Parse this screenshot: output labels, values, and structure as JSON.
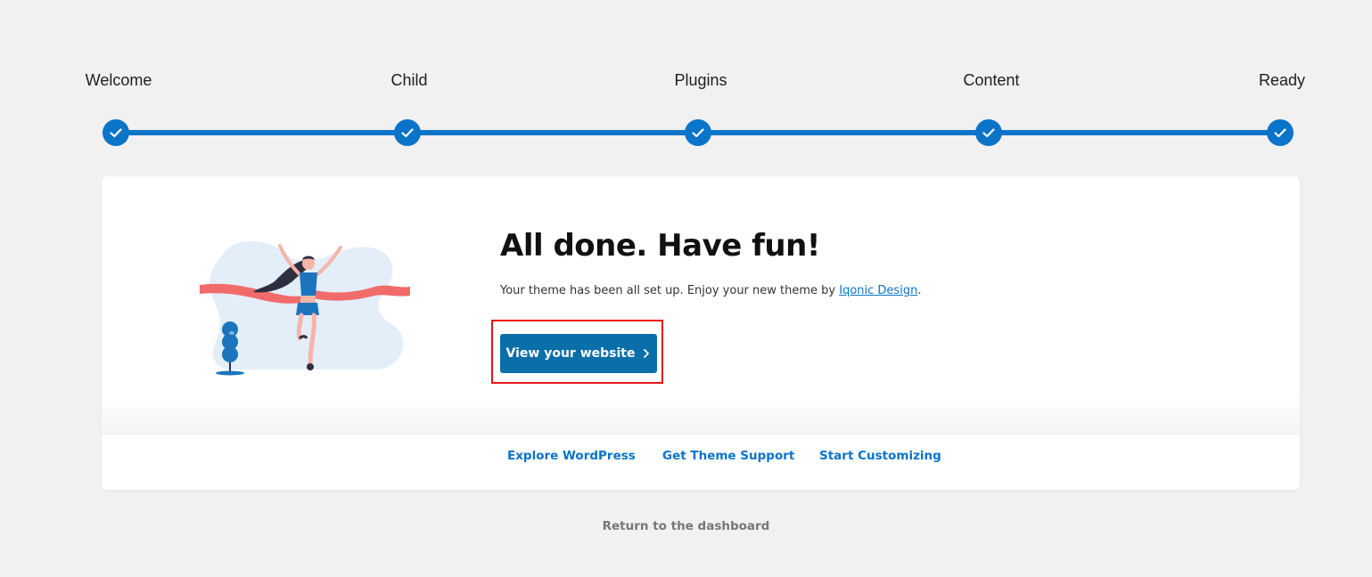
{
  "steps": [
    {
      "label": "Welcome",
      "status": "complete"
    },
    {
      "label": "Child",
      "status": "complete"
    },
    {
      "label": "Plugins",
      "status": "complete"
    },
    {
      "label": "Content",
      "status": "complete"
    },
    {
      "label": "Ready",
      "status": "complete"
    }
  ],
  "colors": {
    "accent": "#0a74c9",
    "button": "#0a6fa8",
    "highlight": "#e8141b",
    "ribbon": "#f26b6b"
  },
  "main": {
    "headline": "All done. Have fun!",
    "subtext_prefix": "Your theme has been all set up. Enjoy your new theme by ",
    "author_link": "Iqonic Design",
    "subtext_suffix": ".",
    "cta_label": "View your website",
    "cta_icon": "chevron-right-icon",
    "illustration": "finish-line-runner-illustration"
  },
  "footer": {
    "links": [
      "Explore WordPress",
      "Get Theme Support",
      "Start Customizing"
    ]
  },
  "return_link": "Return to the dashboard"
}
